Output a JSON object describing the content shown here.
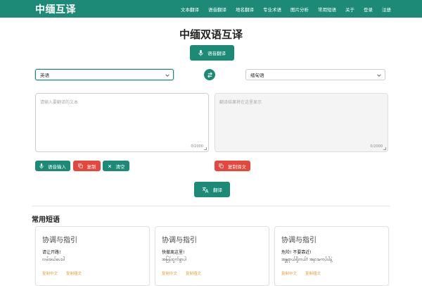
{
  "navbar": {
    "brand": "中缅互译",
    "links": [
      "文本翻译",
      "语音翻译",
      "地名翻译",
      "专业术语",
      "图片分析",
      "常用短语",
      "关于",
      "登录",
      "注册"
    ]
  },
  "page_title": "中缅双语互译",
  "voice_translate_label": "语音翻译",
  "source_select": {
    "value": "英语"
  },
  "target_select": {
    "value": "缅甸语"
  },
  "input_box": {
    "placeholder": "请输入要翻译的文本",
    "counter": "0/2000"
  },
  "output_box": {
    "placeholder": "翻译结果将在这里显示",
    "counter": "0/2000"
  },
  "actions": {
    "voice_input": "语音输入",
    "copy": "复制",
    "clear": "清空",
    "copy_translation": "复制译文"
  },
  "translate_label": "翻译",
  "phrases_section": {
    "title": "常用短语",
    "cards": [
      {
        "title": "协调与指引",
        "zh": "请让开路!",
        "my": "လမ်းဖယ်ပေးပါ",
        "copy_zh": "复制中文",
        "copy_tr": "复制缅文"
      },
      {
        "title": "协调与指引",
        "zh": "快撤离这里!",
        "my": "အမြန်ထွက်ခွာပါ",
        "copy_zh": "复制中文",
        "copy_tr": "复制缅文"
      },
      {
        "title": "协调与指引",
        "zh": "危险! 不要靠近!",
        "my": "အန္တရာယ်ရှိတယ်! အနားမကပ်ပါနဲ့",
        "copy_zh": "复制中文",
        "copy_tr": "复制缅文"
      }
    ]
  },
  "colors": {
    "primary": "#1d8a78",
    "danger": "#e5473c",
    "link": "#e8a23a"
  }
}
